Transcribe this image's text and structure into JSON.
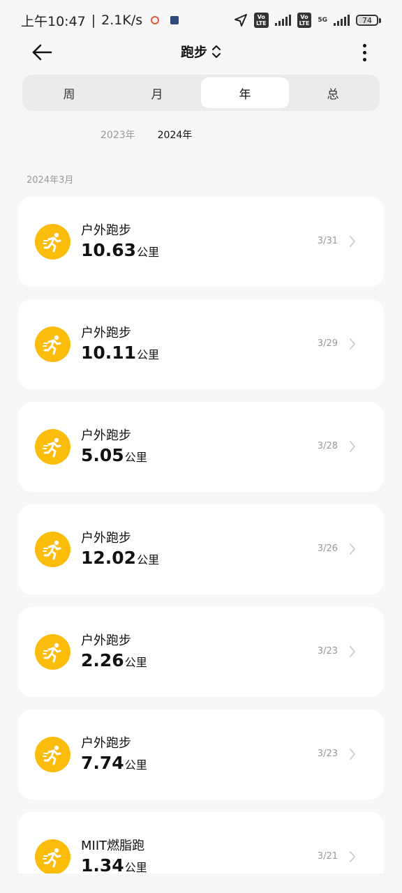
{
  "status_bar": {
    "time": "上午10:47",
    "speed": "2.1K/s",
    "battery": "74",
    "battery_level_percent": 74,
    "network": "5G"
  },
  "header": {
    "title": "跑步"
  },
  "tabs": [
    {
      "label": "周",
      "active": false
    },
    {
      "label": "月",
      "active": false
    },
    {
      "label": "年",
      "active": true
    },
    {
      "label": "总",
      "active": false
    }
  ],
  "years": [
    {
      "label": "2023年",
      "active": false
    },
    {
      "label": "2024年",
      "active": true
    }
  ],
  "section_date": "2024年3月",
  "records": [
    {
      "name": "户外跑步",
      "distance": "10.63",
      "unit": "公里",
      "date": "3/31"
    },
    {
      "name": "户外跑步",
      "distance": "10.11",
      "unit": "公里",
      "date": "3/29"
    },
    {
      "name": "户外跑步",
      "distance": "5.05",
      "unit": "公里",
      "date": "3/28"
    },
    {
      "name": "户外跑步",
      "distance": "12.02",
      "unit": "公里",
      "date": "3/26"
    },
    {
      "name": "户外跑步",
      "distance": "2.26",
      "unit": "公里",
      "date": "3/23"
    },
    {
      "name": "户外跑步",
      "distance": "7.74",
      "unit": "公里",
      "date": "3/23"
    },
    {
      "name": "MIIT燃脂跑",
      "distance": "1.34",
      "unit": "公里",
      "date": "3/21"
    }
  ],
  "colors": {
    "accent": "#fcbc0c",
    "background": "#f7f7f7"
  }
}
